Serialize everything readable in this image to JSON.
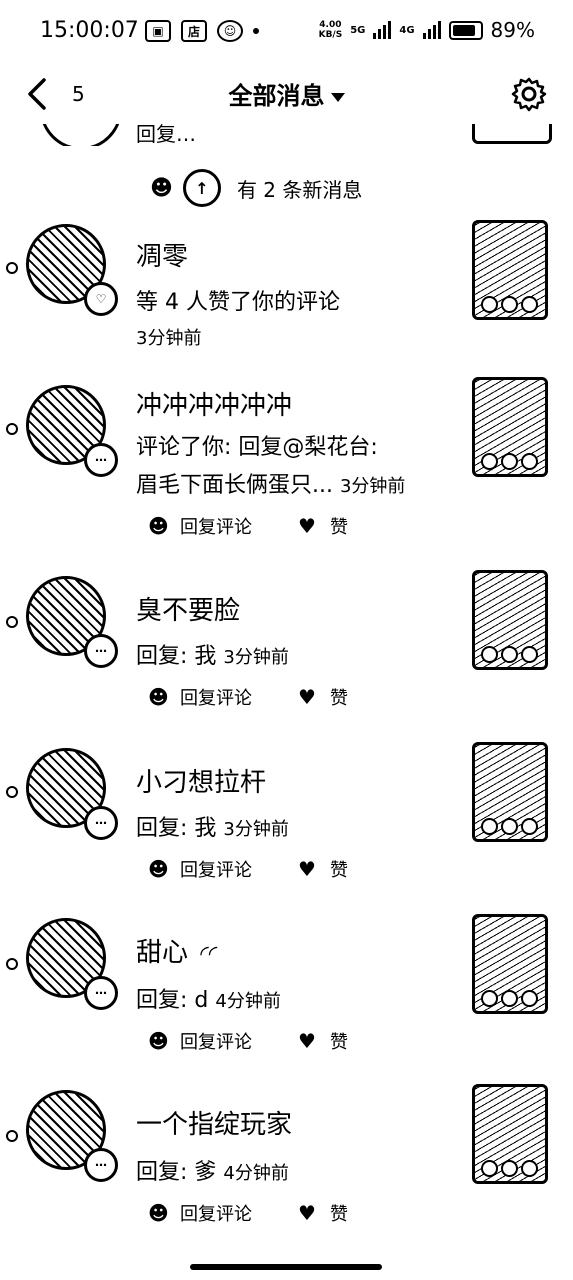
{
  "status": {
    "time": "15:00:07",
    "speed_value": "4.00",
    "speed_unit": "KB/S",
    "net1": "5G",
    "net2": "4G",
    "battery": "89%"
  },
  "nav": {
    "back_count": "5",
    "title": "全部消息"
  },
  "partial_item": {
    "text": "回复…"
  },
  "new_messages": "有 2 条新消息",
  "actions": {
    "reply": "回复评论",
    "like": "赞"
  },
  "items": [
    {
      "name": "凋零",
      "line1": "等 4 人赞了你的评论",
      "line2": "",
      "time": "3分钟前",
      "badge": "heart"
    },
    {
      "name": "冲冲冲冲冲冲",
      "line1": "评论了你: 回复@梨花台:",
      "line2": "眉毛下面长俩蛋只...",
      "time": "3分钟前",
      "badge": "comment"
    },
    {
      "name": "臭不要脸",
      "line1": "回复: 我",
      "line2": "",
      "time": "3分钟前",
      "badge": "comment"
    },
    {
      "name": "小刁想拉杆",
      "line1": "回复: 我",
      "line2": "",
      "time": "3分钟前",
      "badge": "comment"
    },
    {
      "name": "甜心",
      "line1": "回复: d",
      "line2": "",
      "time": "4分钟前",
      "badge": "comment"
    },
    {
      "name": "一个指绽玩家",
      "line1": "回复: 爹",
      "line2": "",
      "time": "4分钟前",
      "badge": "comment"
    }
  ]
}
